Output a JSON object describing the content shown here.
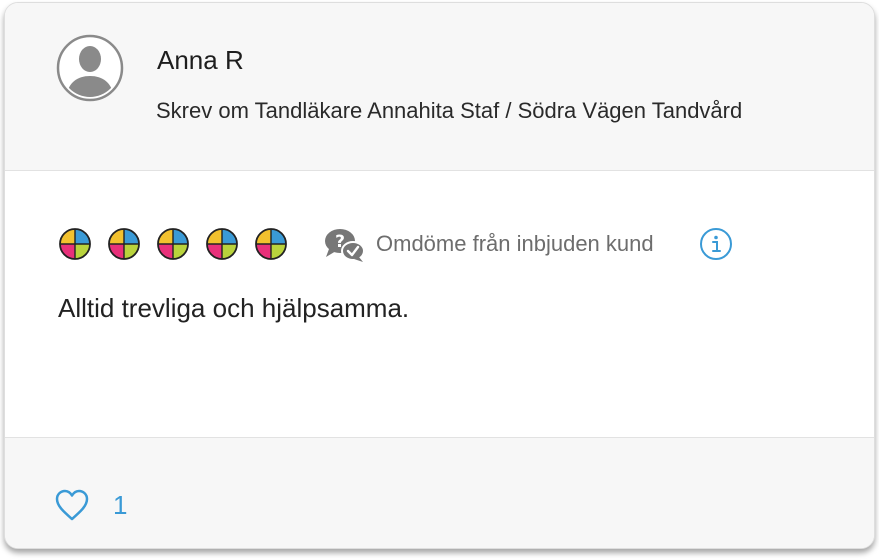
{
  "review": {
    "reviewer_name": "Anna R",
    "wrote_about": "Skrev om Tandläkare Annahita Staf / Södra Vägen Tandvård",
    "rating": 5,
    "rating_max": 5,
    "badge_text": "Omdöme från inbjuden kund",
    "text": "Alltid trevliga och hjälpsamma.",
    "likes": "1"
  },
  "icons": {
    "avatar": "person-avatar-icon",
    "rating_mark": "quadrant-circle-icon",
    "badge": "speech-bubbles-question-check-icon",
    "info": "info-circle-icon",
    "like": "heart-outline-icon"
  },
  "colors": {
    "accent": "#3a9ad6",
    "rating_yellow": "#f2c12e",
    "rating_blue": "#3a9ad6",
    "rating_pink": "#e8307a",
    "rating_green": "#b9d33c",
    "header_bg": "#f7f7f7",
    "muted_text": "#6d6d6d"
  }
}
